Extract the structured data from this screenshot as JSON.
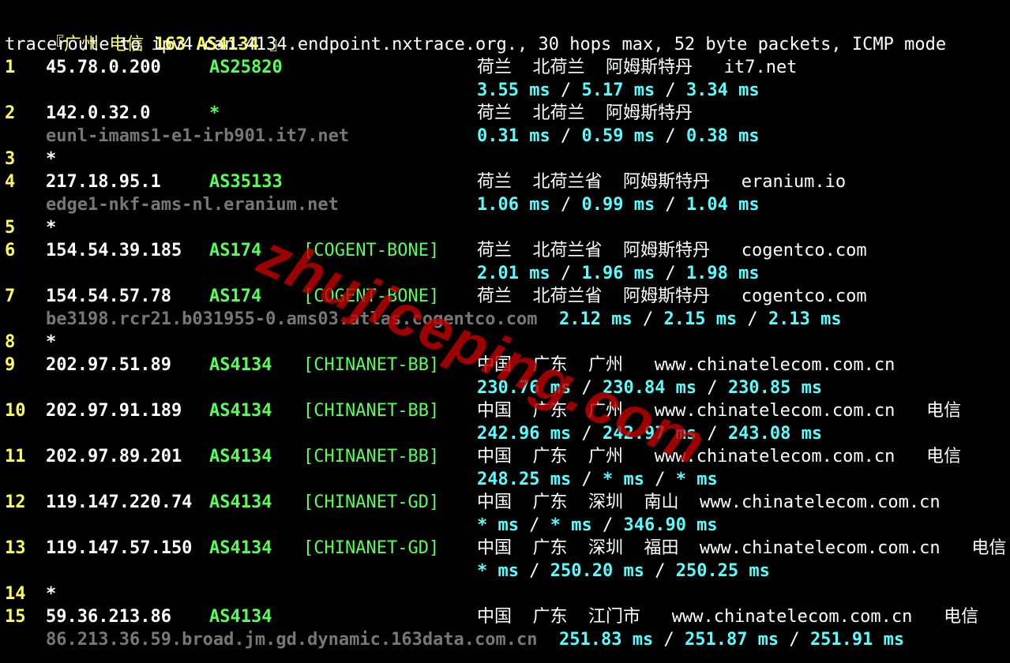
{
  "header": {
    "title_prefix": "『广州 电信",
    "title_bold": "163 AS4134",
    "title_suffix": "』",
    "command": "traceroute to ipv4.can-4134.endpoint.nxtrace.org., 30 hops max, 52 byte packets, ICMP mode"
  },
  "watermark": "zhujiceping.com",
  "colors": {
    "hop_number": "#ffff55",
    "asn": "#55ff55",
    "rtt": "#55ffff",
    "hostname": "#777777",
    "watermark": "#c00000"
  },
  "hops": [
    {
      "n": "1",
      "ip": "45.78.0.200",
      "asn": "AS25820",
      "tag": "",
      "geo": "荷兰  北荷兰  阿姆斯特丹   it7.net",
      "host": "",
      "rtt": [
        "3.55 ms",
        "5.17 ms",
        "3.34 ms"
      ]
    },
    {
      "n": "2",
      "ip": "142.0.32.0",
      "asn": "*",
      "tag": "",
      "geo": "荷兰  北荷兰  阿姆斯特丹",
      "host": "eunl-imams1-e1-irb901.it7.net",
      "rtt": [
        "0.31 ms",
        "0.59 ms",
        "0.38 ms"
      ]
    },
    {
      "n": "3",
      "star": "*"
    },
    {
      "n": "4",
      "ip": "217.18.95.1",
      "asn": "AS35133",
      "tag": "",
      "geo": "荷兰  北荷兰省  阿姆斯特丹   eranium.io",
      "host": "edge1-nkf-ams-nl.eranium.net",
      "rtt": [
        "1.06 ms",
        "0.99 ms",
        "1.04 ms"
      ]
    },
    {
      "n": "5",
      "star": "*"
    },
    {
      "n": "6",
      "ip": "154.54.39.185",
      "asn": "AS174",
      "tag": "[COGENT-BONE]",
      "geo": "荷兰  北荷兰省  阿姆斯特丹   cogentco.com",
      "host": "",
      "rtt": [
        "2.01 ms",
        "1.96 ms",
        "1.98 ms"
      ]
    },
    {
      "n": "7",
      "ip": "154.54.57.78",
      "asn": "AS174",
      "tag": "[COGENT-BONE]",
      "geo": "荷兰  北荷兰省  阿姆斯特丹   cogentco.com",
      "host": "be3198.rcr21.b031955-0.ams03.atlas.cogentco.com",
      "rtt": [
        "2.12 ms",
        "2.15 ms",
        "2.13 ms"
      ]
    },
    {
      "n": "8",
      "star": "*"
    },
    {
      "n": "9",
      "ip": "202.97.51.89",
      "asn": "AS4134",
      "tag": "[CHINANET-BB]",
      "geo": "中国  广东  广州   www.chinatelecom.com.cn",
      "host": "",
      "rtt": [
        "230.76 ms",
        "230.84 ms",
        "230.85 ms"
      ]
    },
    {
      "n": "10",
      "ip": "202.97.91.189",
      "asn": "AS4134",
      "tag": "[CHINANET-BB]",
      "geo": "中国  广东  广州   www.chinatelecom.com.cn   电信",
      "host": "",
      "rtt": [
        "242.96 ms",
        "242.97 ms",
        "243.08 ms"
      ]
    },
    {
      "n": "11",
      "ip": "202.97.89.201",
      "asn": "AS4134",
      "tag": "[CHINANET-BB]",
      "geo": "中国  广东  广州   www.chinatelecom.com.cn   电信",
      "host": "",
      "rtt": [
        "248.25 ms",
        "* ms",
        "* ms"
      ]
    },
    {
      "n": "12",
      "ip": "119.147.220.74",
      "asn": "AS4134",
      "tag": "[CHINANET-GD]",
      "geo": "中国  广东  深圳  南山  www.chinatelecom.com.cn",
      "host": "",
      "rtt": [
        "* ms",
        "* ms",
        "346.90 ms"
      ]
    },
    {
      "n": "13",
      "ip": "119.147.57.150",
      "asn": "AS4134",
      "tag": "[CHINANET-GD]",
      "geo": "中国  广东  深圳  福田  www.chinatelecom.com.cn   电信",
      "host": "",
      "rtt": [
        "* ms",
        "250.20 ms",
        "250.25 ms"
      ]
    },
    {
      "n": "14",
      "star": "*"
    },
    {
      "n": "15",
      "ip": "59.36.213.86",
      "asn": "AS4134",
      "tag": "",
      "geo": "中国  广东  江门市   www.chinatelecom.com.cn   电信",
      "host": "86.213.36.59.broad.jm.gd.dynamic.163data.com.cn",
      "rtt": [
        "251.83 ms",
        "251.87 ms",
        "251.91 ms"
      ]
    }
  ]
}
